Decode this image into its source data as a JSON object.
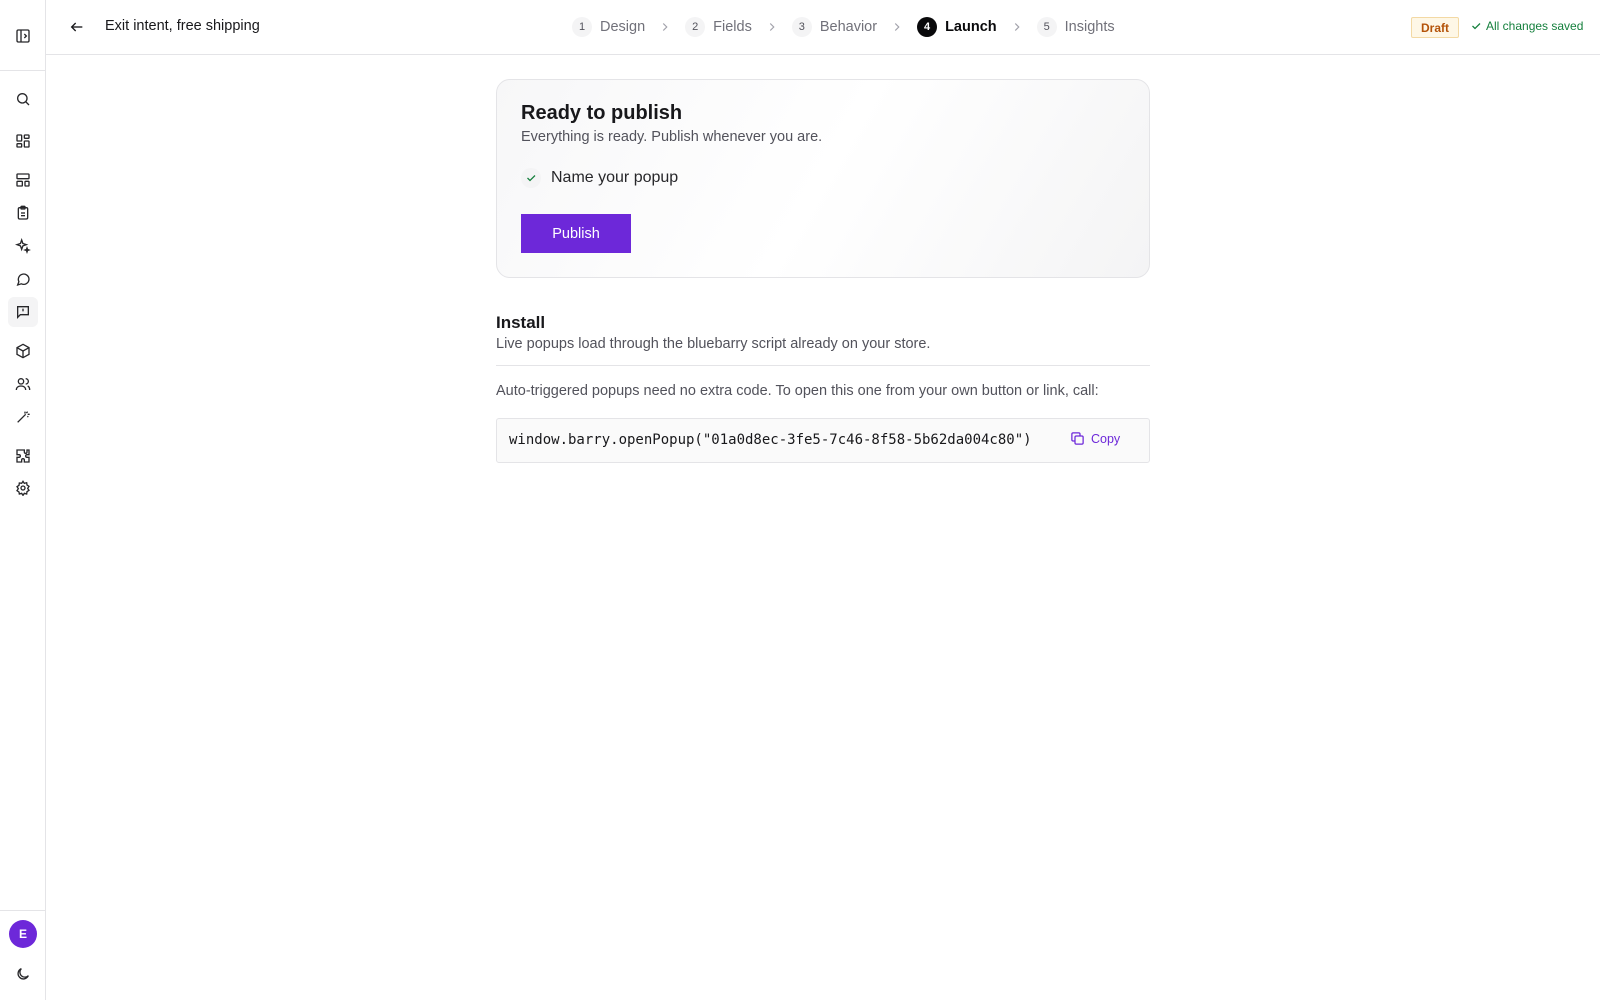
{
  "header": {
    "title": "Exit intent, free shipping",
    "steps": [
      {
        "num": "1",
        "label": "Design"
      },
      {
        "num": "2",
        "label": "Fields"
      },
      {
        "num": "3",
        "label": "Behavior"
      },
      {
        "num": "4",
        "label": "Launch"
      },
      {
        "num": "5",
        "label": "Insights"
      }
    ],
    "current_step": "4",
    "status_badge": "Draft",
    "save_status": "All changes saved"
  },
  "sidebar": {
    "icons": [
      "panel-toggle-icon",
      "search-icon",
      "dashboard-icon",
      "layout-icon",
      "clipboard-icon",
      "sparkles-icon",
      "chat-icon",
      "popup-message-icon",
      "box-icon",
      "users-icon",
      "magic-wand-icon",
      "puzzle-icon",
      "settings-icon"
    ],
    "active_item": "popup-message-icon",
    "avatar_initial": "E",
    "theme_icon": "moon-icon"
  },
  "publish": {
    "title": "Ready to publish",
    "subtitle": "Everything is ready. Publish whenever you are.",
    "checklist": [
      {
        "label": "Name your popup",
        "done": true
      }
    ],
    "button_label": "Publish"
  },
  "install": {
    "title": "Install",
    "subtitle": "Live popups load through the bluebarry script already on your store.",
    "note": "Auto-triggered popups need no extra code. To open this one from your own button or link, call:",
    "code": "window.barry.openPopup(\"01a0d8ec-3fe5-7c46-8f58-5b62da004c80\")",
    "copy_label": "Copy"
  },
  "colors": {
    "accent": "#6d28d9",
    "success": "#15803d",
    "draft_text": "#b45309",
    "draft_bg": "#fef7e6"
  }
}
